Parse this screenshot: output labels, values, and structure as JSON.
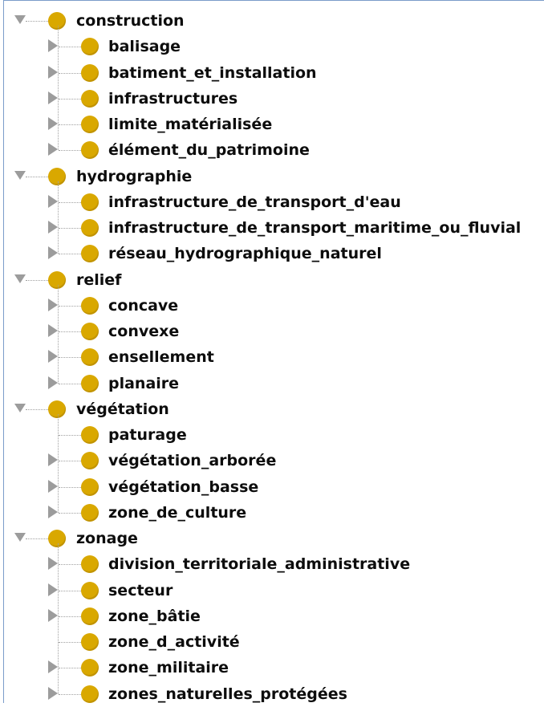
{
  "tree": [
    {
      "label": "construction",
      "expanded": true,
      "children": [
        {
          "label": "balisage",
          "has_children": true
        },
        {
          "label": "batiment_et_installation",
          "has_children": true
        },
        {
          "label": "infrastructures",
          "has_children": true
        },
        {
          "label": "limite_matérialisée",
          "has_children": true
        },
        {
          "label": "élément_du_patrimoine",
          "has_children": true
        }
      ]
    },
    {
      "label": "hydrographie",
      "expanded": true,
      "children": [
        {
          "label": "infrastructure_de_transport_d'eau",
          "has_children": true
        },
        {
          "label": "infrastructure_de_transport_maritime_ou_fluvial",
          "has_children": true
        },
        {
          "label": "réseau_hydrographique_naturel",
          "has_children": true
        }
      ]
    },
    {
      "label": "relief",
      "expanded": true,
      "children": [
        {
          "label": "concave",
          "has_children": true
        },
        {
          "label": "convexe",
          "has_children": true
        },
        {
          "label": "ensellement",
          "has_children": true
        },
        {
          "label": "planaire",
          "has_children": true
        }
      ]
    },
    {
      "label": "végétation",
      "expanded": true,
      "children": [
        {
          "label": "paturage",
          "has_children": false
        },
        {
          "label": "végétation_arborée",
          "has_children": true
        },
        {
          "label": "végétation_basse",
          "has_children": true
        },
        {
          "label": "zone_de_culture",
          "has_children": true
        }
      ]
    },
    {
      "label": "zonage",
      "expanded": true,
      "children": [
        {
          "label": "division_territoriale_administrative",
          "has_children": true
        },
        {
          "label": "secteur",
          "has_children": true
        },
        {
          "label": "zone_bâtie",
          "has_children": true
        },
        {
          "label": "zone_d_activité",
          "has_children": false
        },
        {
          "label": "zone_militaire",
          "has_children": true
        },
        {
          "label": "zones_naturelles_protégées",
          "has_children": true
        }
      ]
    }
  ],
  "colors": {
    "node_icon": "#d9a800",
    "expander": "#9c9c9c",
    "text": "#0d0d0d",
    "frame_border": "#7a9cc9"
  },
  "icons": {
    "node": "class-node-icon",
    "expanded": "expand-down-icon",
    "collapsed": "collapsed-arrow-icon"
  }
}
